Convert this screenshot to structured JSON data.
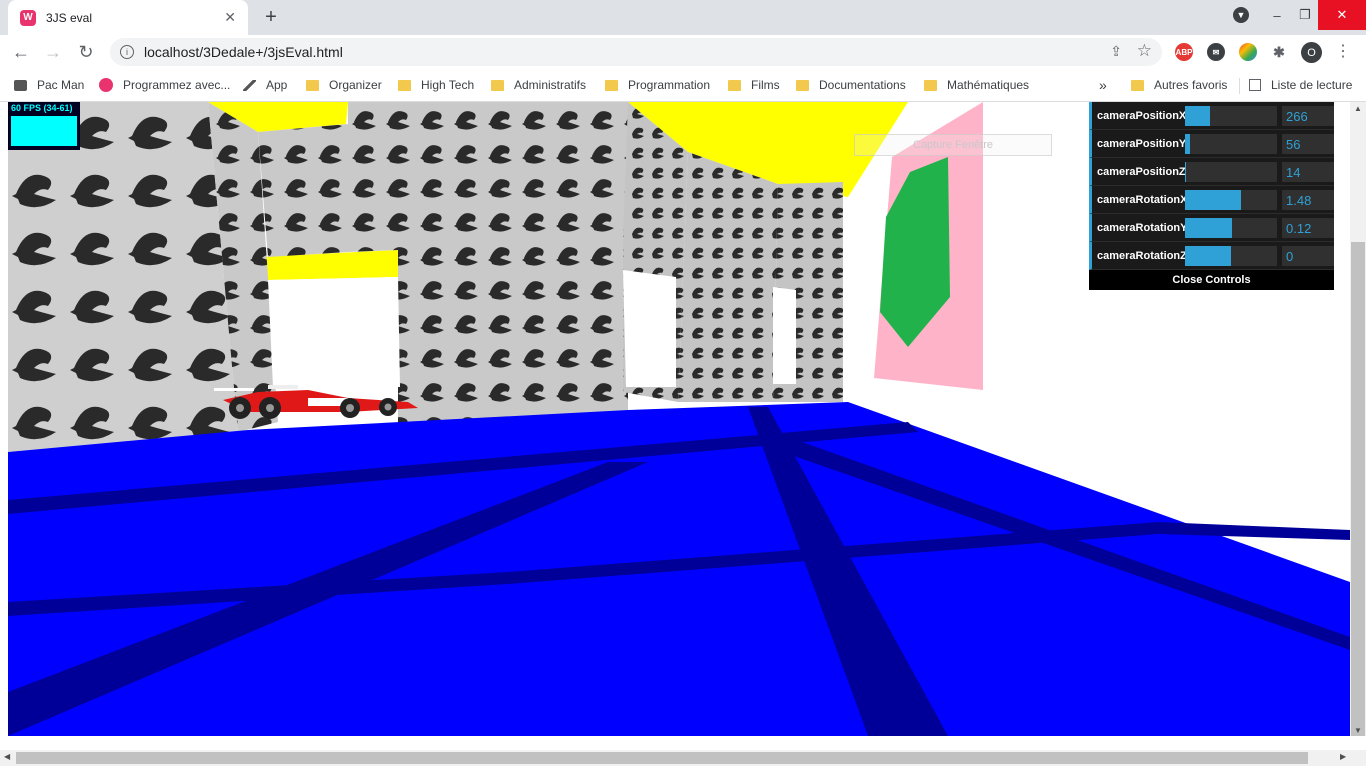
{
  "browser": {
    "tab_title": "3JS eval",
    "tab_favicon": "W",
    "tab_close": "✕",
    "new_tab": "+",
    "url": "localhost/3Dedale+/3jsEval.html",
    "avatar_letter": "O",
    "min": "–",
    "max": "❐",
    "close": "✕"
  },
  "bookmarks": {
    "items": [
      {
        "label": "Pac Man",
        "icon": "pacman-icon"
      },
      {
        "label": "Programmez avec...",
        "icon": "openclassrooms-icon"
      },
      {
        "label": "App",
        "icon": "app-icon"
      },
      {
        "label": "Organizer",
        "icon": "folder-icon"
      },
      {
        "label": "High Tech",
        "icon": "folder-icon"
      },
      {
        "label": "Administratifs",
        "icon": "folder-icon"
      },
      {
        "label": "Programmation",
        "icon": "folder-icon"
      },
      {
        "label": "Films",
        "icon": "folder-icon"
      },
      {
        "label": "Documentations",
        "icon": "folder-icon"
      },
      {
        "label": "Mathématiques",
        "icon": "folder-icon"
      }
    ],
    "overflow": "»",
    "other": "Autres favoris",
    "reading_list": "Liste de lecture"
  },
  "extensions": {
    "abp": "ABP"
  },
  "stats": {
    "fps_text": "60 FPS (34-61)",
    "fps": 60
  },
  "capture_button": "Capture Fenêtre",
  "gui": {
    "controls": [
      {
        "label": "cameraPositionX",
        "value": "266",
        "fill": 0.27
      },
      {
        "label": "cameraPositionY",
        "value": "56",
        "fill": 0.05
      },
      {
        "label": "cameraPositionZ",
        "value": "14",
        "fill": 0.01
      },
      {
        "label": "cameraRotationX",
        "value": "1.48",
        "fill": 0.61
      },
      {
        "label": "cameraRotationY",
        "value": "0.12",
        "fill": 0.51
      },
      {
        "label": "cameraRotationZ",
        "value": "0",
        "fill": 0.5
      }
    ],
    "close_label": "Close Controls"
  },
  "colors": {
    "floor": "#0000ff",
    "floor_lines": "#000099",
    "ceiling": "#ffff00",
    "accent": "#2fa1d6",
    "sign_pink": "#ffb3c9",
    "sign_green": "#22b24c"
  }
}
